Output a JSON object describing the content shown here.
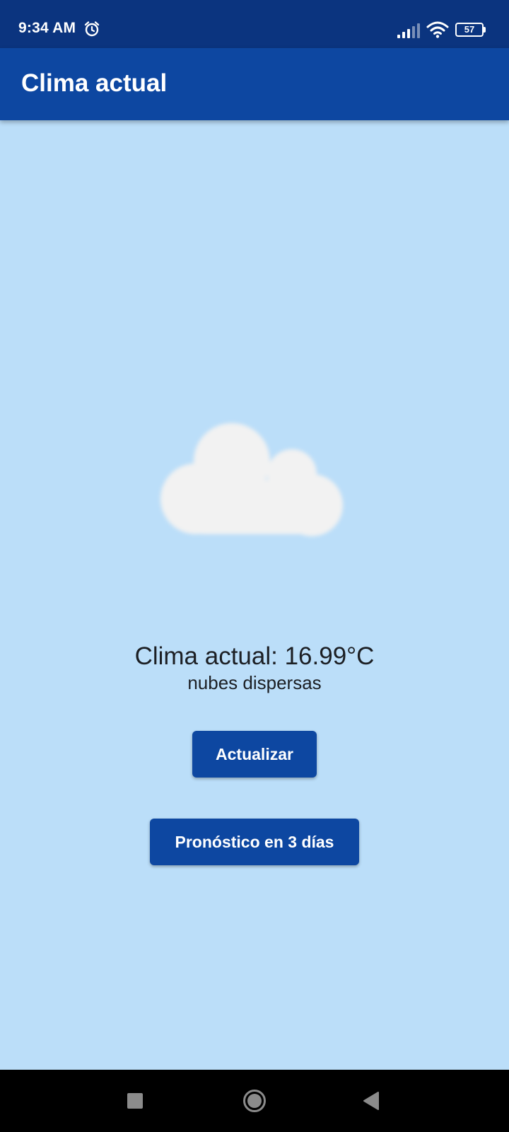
{
  "status_bar": {
    "time": "9:34 AM",
    "battery_level": "57",
    "icons": [
      "alarm-icon",
      "cell-signal-icon",
      "wifi-icon",
      "battery-icon"
    ]
  },
  "app_bar": {
    "title": "Clima actual"
  },
  "weather": {
    "icon": "cloud-icon",
    "temperature_text": "Clima actual: 16.99°C",
    "description": "nubes dispersas"
  },
  "actions": {
    "refresh_label": "Actualizar",
    "forecast_label": "Pronóstico en 3 días"
  },
  "nav_bar": {
    "buttons": [
      "recents-icon",
      "home-icon",
      "back-icon"
    ]
  },
  "colors": {
    "status_bar": "#0b347f",
    "app_bar": "#0d47a1",
    "background": "#bbdef9",
    "button": "#0d47a1",
    "cloud": "#f2f2f2",
    "text": "#1c1f24"
  }
}
